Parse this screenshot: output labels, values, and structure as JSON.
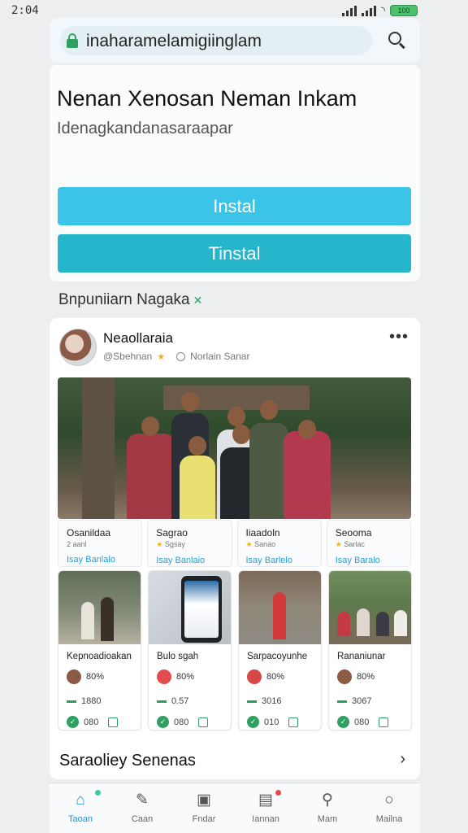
{
  "status_bar": {
    "time": "2:04",
    "battery": "100"
  },
  "url_bar": {
    "url": "inaharamelamigiinglam"
  },
  "hero": {
    "title": "Nenan Xenosan Neman Inkam",
    "subtitle": "Idenagkandanasaraapar",
    "primary_button": "Instal",
    "secondary_button": "Tinstal"
  },
  "section": {
    "title": "Bnpuniiarn Nagaka"
  },
  "post": {
    "author": "Neaollaraia",
    "handle": "@Sbehnan",
    "location": "Norlain Sanar",
    "stats": [
      {
        "title": "Osanildaa",
        "sub": "2 aanl",
        "link": "Isay Banlalo"
      },
      {
        "title": "Sagrao",
        "sub": "Sgsay",
        "link": "Isay Banlaio"
      },
      {
        "title": "Iiaadoln",
        "sub": "Sanao",
        "link": "Isay Barlelo"
      },
      {
        "title": "Seooma",
        "sub": "Sarlac",
        "link": "Isay Baralo"
      }
    ],
    "cards": [
      {
        "title": "Kepnoadioakan",
        "rating": "80%",
        "price": "1880",
        "count": "080"
      },
      {
        "title": "Bulo sgah",
        "rating": "80%",
        "price": "0.57",
        "count": "080"
      },
      {
        "title": "Sarpacoyunhe",
        "rating": "80%",
        "price": "3016",
        "count": "010"
      },
      {
        "title": "Rananiunar",
        "rating": "80%",
        "price": "3067",
        "count": "080"
      }
    ],
    "more_link": "Saraoliey Senenas"
  },
  "bottom_nav": [
    {
      "label": "Taoan",
      "icon": "home-icon",
      "active": true
    },
    {
      "label": "Caan",
      "icon": "feather-icon"
    },
    {
      "label": "Fndar",
      "icon": "board-icon"
    },
    {
      "label": "Iannan",
      "icon": "inbox-icon"
    },
    {
      "label": "Mam",
      "icon": "user-icon"
    },
    {
      "label": "Mailna",
      "icon": "circle-icon"
    }
  ],
  "colors": {
    "accent": "#3cc3e8",
    "accent_dark": "#25b6cc",
    "green": "#2ea061",
    "link": "#2a9fd6"
  }
}
